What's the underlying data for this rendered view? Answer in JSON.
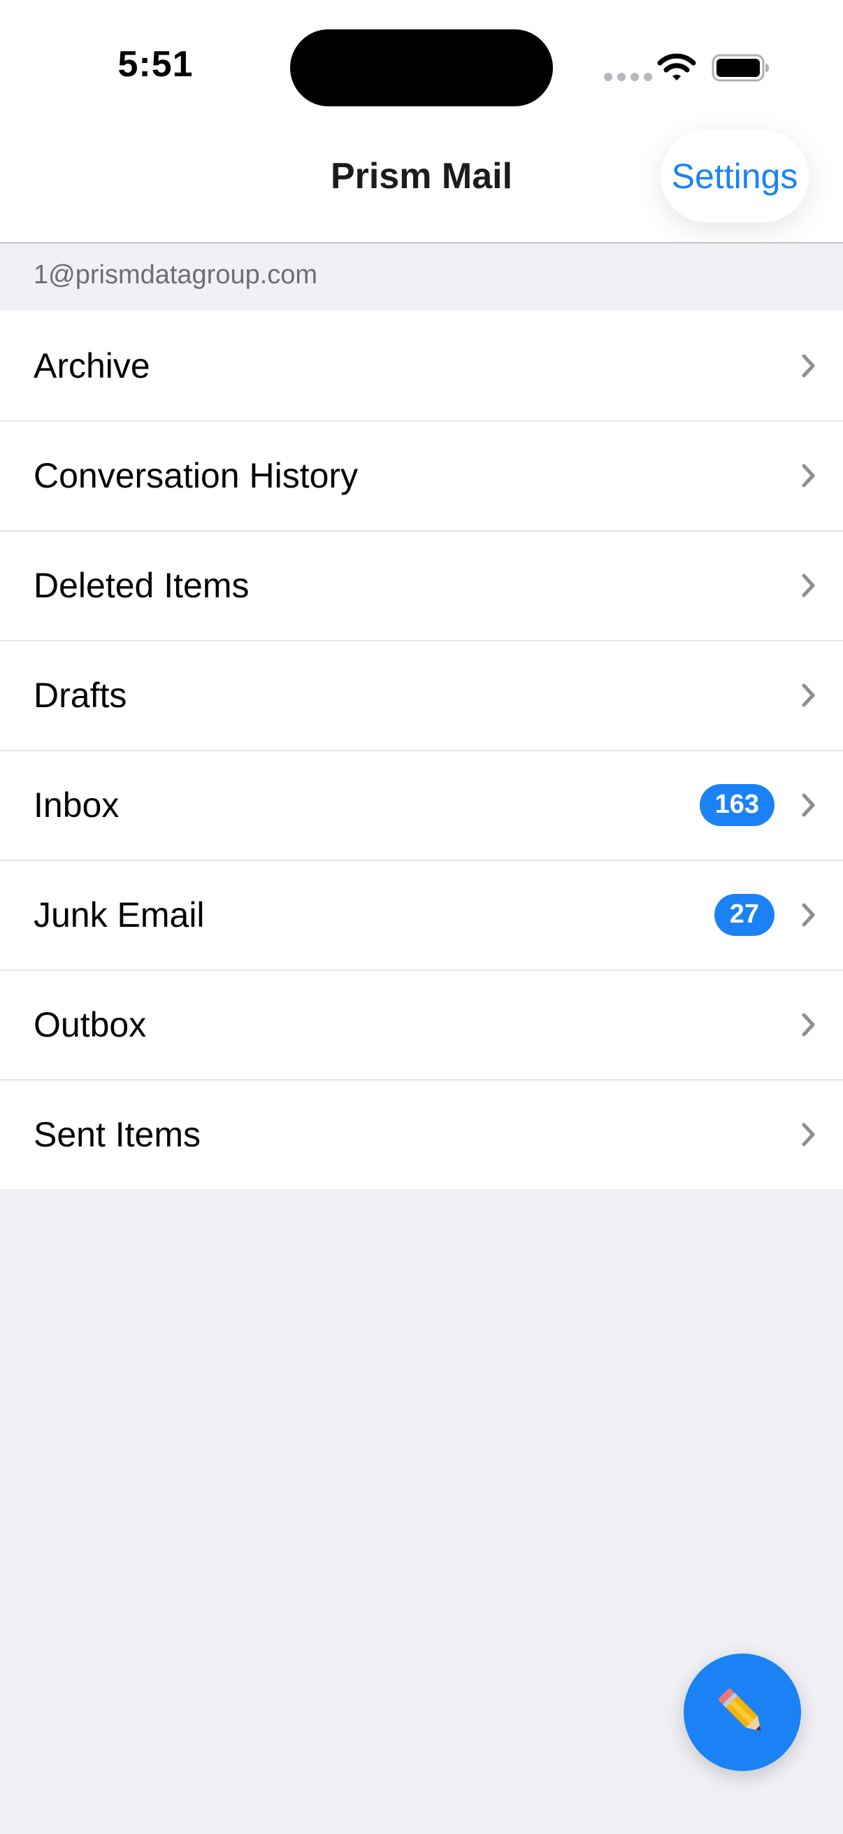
{
  "status_bar": {
    "time": "5:51"
  },
  "nav": {
    "title": "Prism Mail",
    "settings_label": "Settings"
  },
  "account": {
    "email": "1@prismdatagroup.com"
  },
  "folders": [
    {
      "label": "Archive",
      "badge": null
    },
    {
      "label": "Conversation History",
      "badge": null
    },
    {
      "label": "Deleted Items",
      "badge": null
    },
    {
      "label": "Drafts",
      "badge": null
    },
    {
      "label": "Inbox",
      "badge": "163"
    },
    {
      "label": "Junk Email",
      "badge": "27"
    },
    {
      "label": "Outbox",
      "badge": null
    },
    {
      "label": "Sent Items",
      "badge": null
    }
  ],
  "icons": {
    "status": [
      "signal-dots-icon",
      "wifi-icon",
      "battery-icon"
    ],
    "row": "chevron-right-icon",
    "compose": "pencil-icon"
  },
  "colors": {
    "accent": "#1a82f5",
    "background": "#f0f0f5",
    "row_background": "#ffffff",
    "secondary_text": "#6d6d72"
  }
}
